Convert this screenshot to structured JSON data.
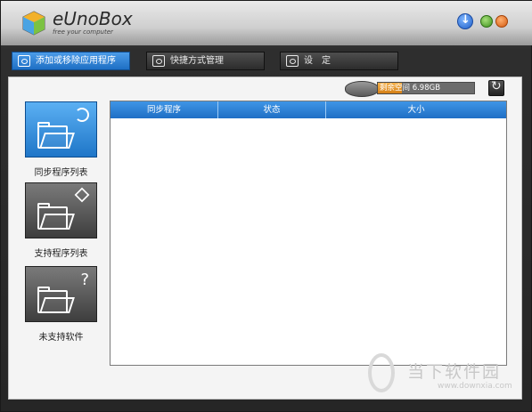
{
  "header": {
    "brand_name": "eUnoBox",
    "brand_tagline": "free your computer",
    "buttons": [
      "download",
      "minimize",
      "close"
    ]
  },
  "tabs": [
    {
      "label": "添加或移除应用程序",
      "active": true
    },
    {
      "label": "快捷方式管理",
      "active": false
    },
    {
      "label": "设　定",
      "active": false
    }
  ],
  "disk": {
    "text": "剩余空间 6.98GB",
    "fill_fraction": 0.25,
    "fill_color": "#e39a2c"
  },
  "sidebar": {
    "items": [
      {
        "label": "同步程序列表",
        "active": true,
        "icon": "folder-sync-icon"
      },
      {
        "label": "支持程序列表",
        "active": false,
        "icon": "folder-box-icon"
      },
      {
        "label": "未支持软件",
        "active": false,
        "icon": "folder-question-icon"
      }
    ]
  },
  "table": {
    "columns": [
      "同步程序",
      "状态",
      "大小"
    ],
    "rows": []
  },
  "watermark": {
    "text": "当下软件园",
    "url": "www.downxia.com"
  },
  "colors": {
    "accent_blue": "#2a7fd4",
    "header_bg": "#d5d5d5",
    "window_dark": "#2e2e2e"
  }
}
